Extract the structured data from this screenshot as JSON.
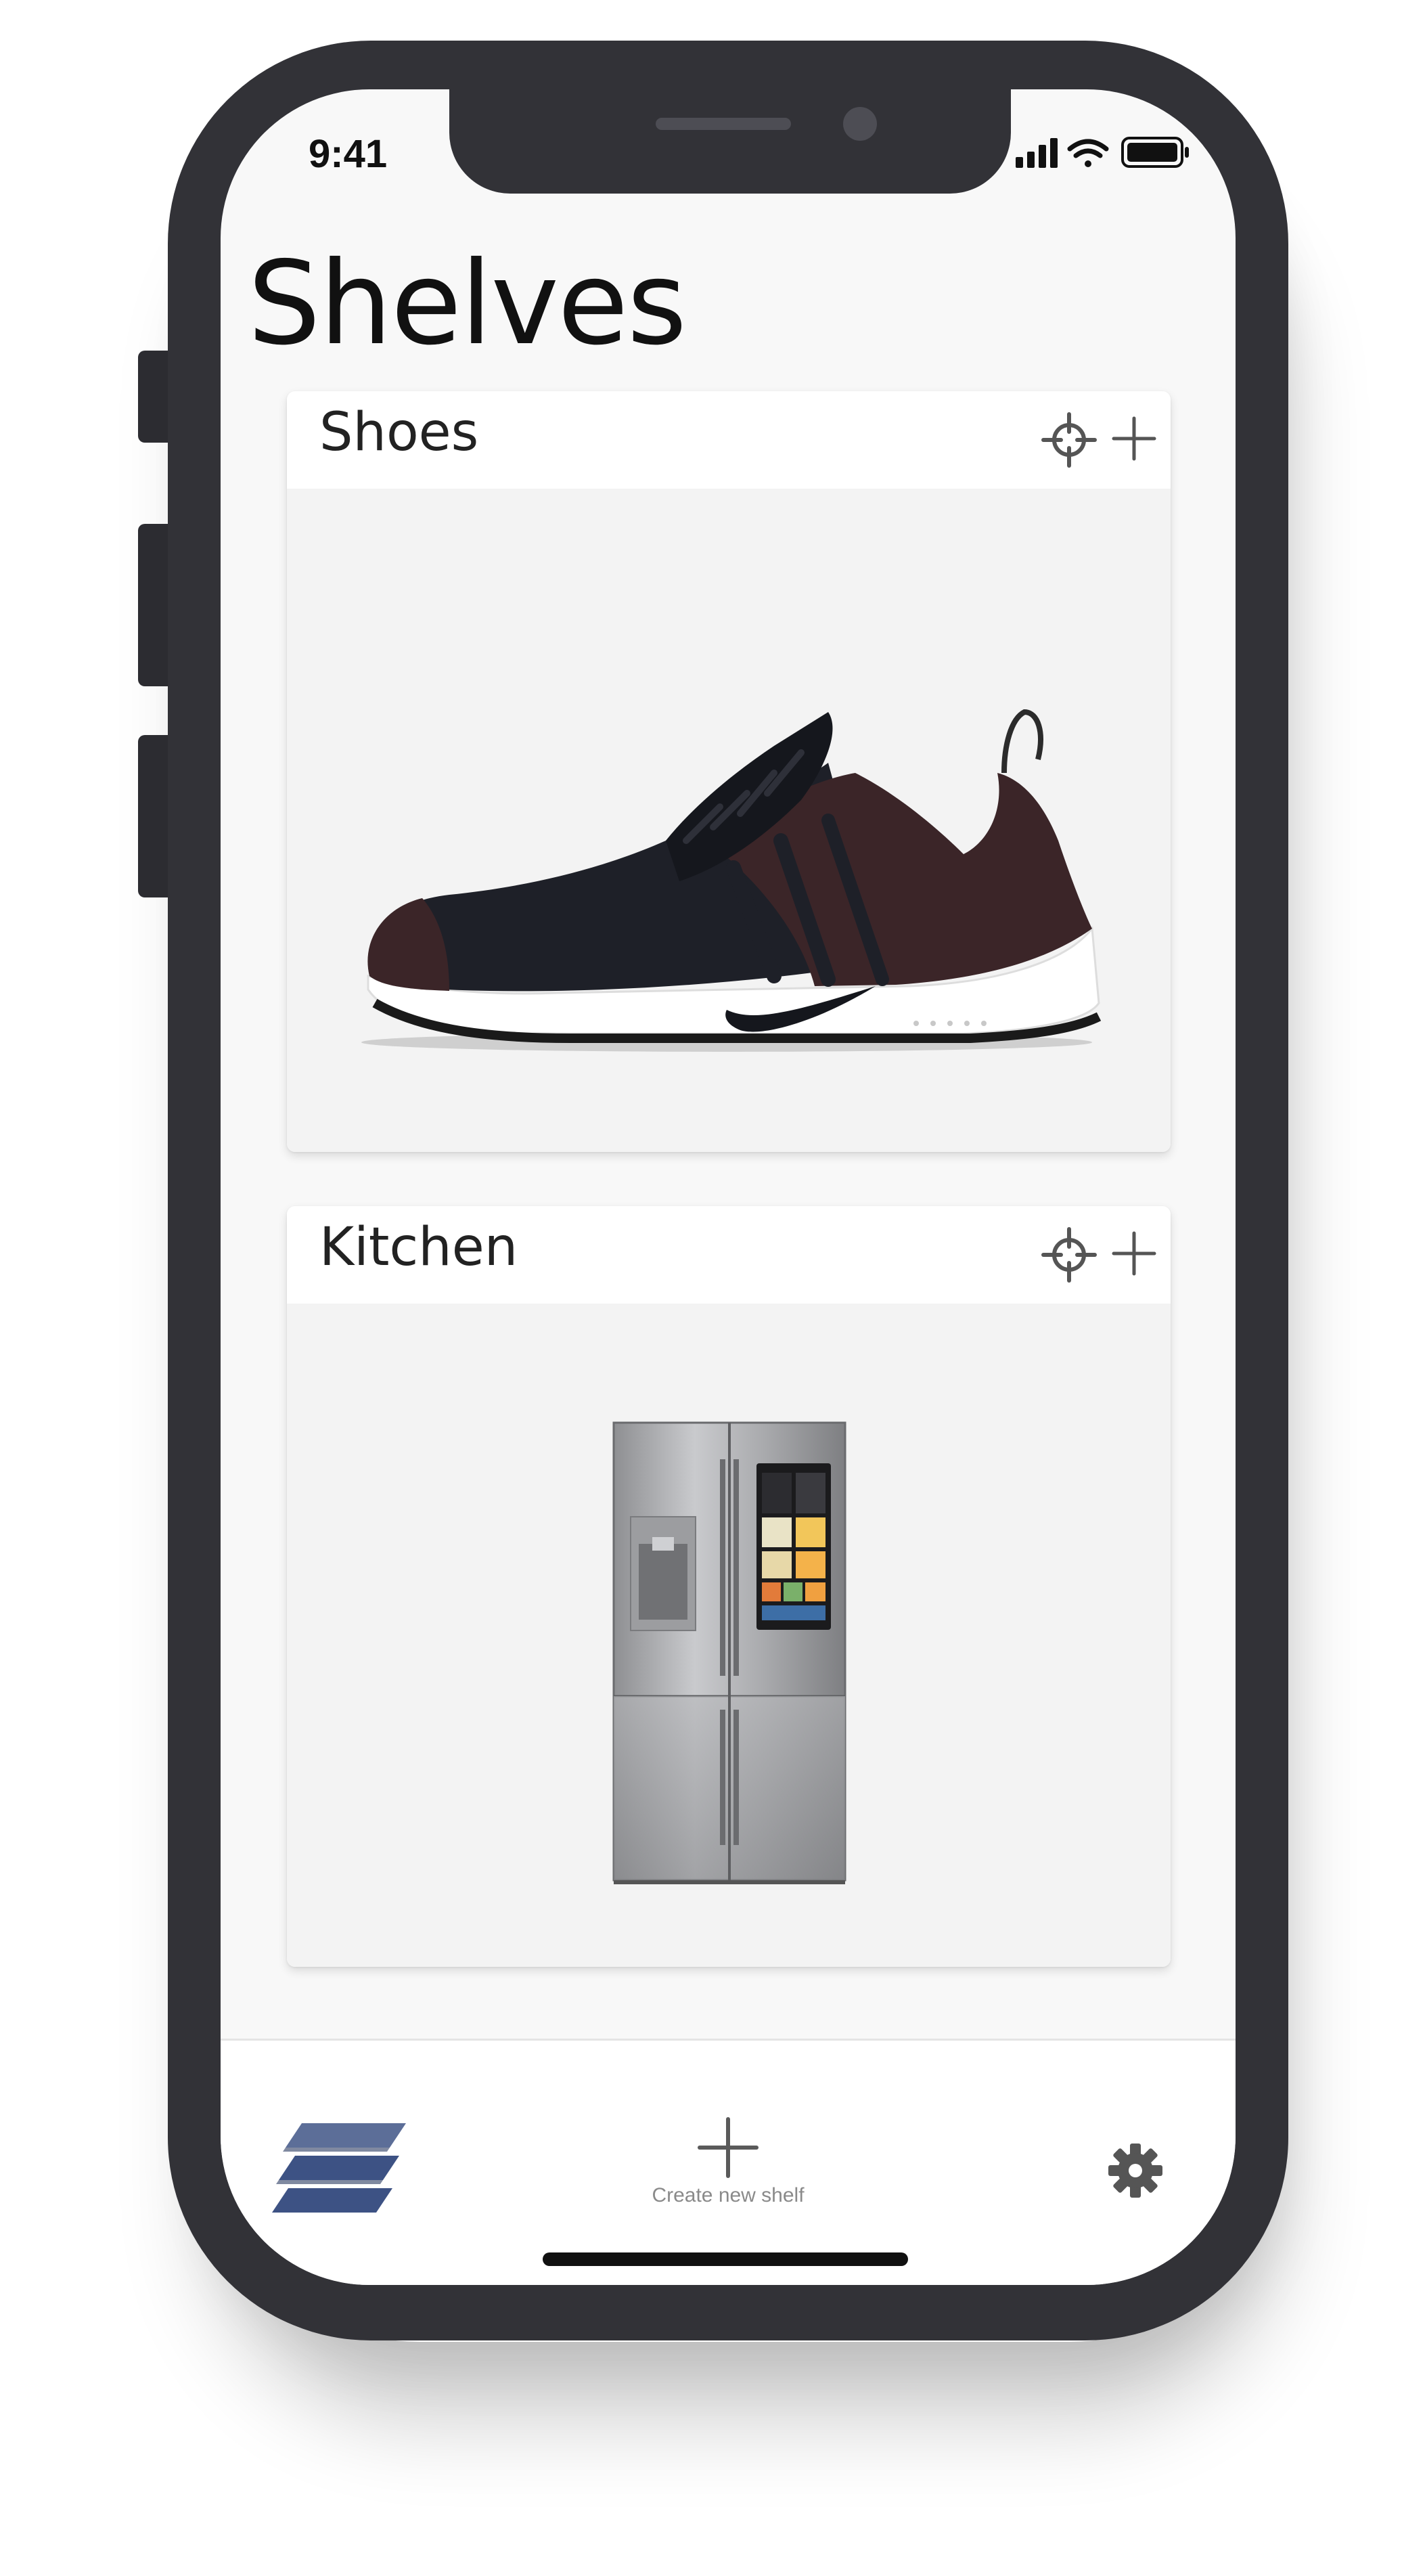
{
  "status_bar": {
    "time": "9:41",
    "signal_icon": "cellular-signal-icon",
    "wifi_icon": "wifi-icon",
    "battery_icon": "battery-icon"
  },
  "page": {
    "title": "Shelves"
  },
  "shelves": [
    {
      "title": "Shoes",
      "locate_icon": "crosshair-icon",
      "add_icon": "plus-icon",
      "image": "sneaker-image"
    },
    {
      "title": "Kitchen",
      "locate_icon": "crosshair-icon",
      "add_icon": "plus-icon",
      "image": "refrigerator-image"
    }
  ],
  "bottom_bar": {
    "shelves_icon": "stacked-shelves-icon",
    "create_icon": "plus-icon",
    "create_label": "Create new shelf",
    "settings_icon": "gear-icon"
  },
  "colors": {
    "accent": "#4a5f8c",
    "background": "#f8f8f8",
    "card": "#f3f3f3",
    "phone_frame": "#323237"
  }
}
